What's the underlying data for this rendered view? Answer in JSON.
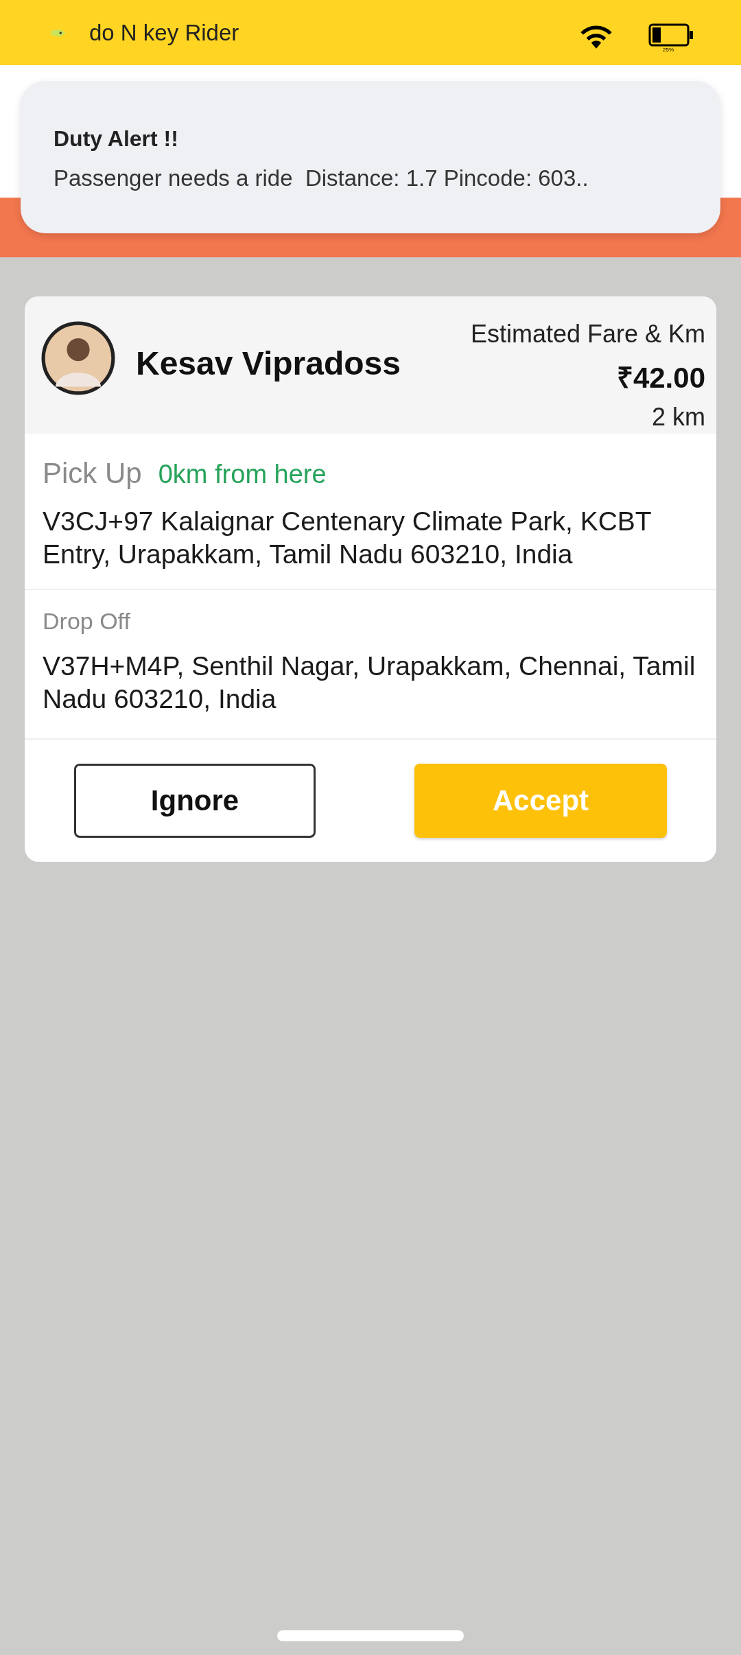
{
  "status_bar": {
    "app_name": "do N key Rider",
    "battery_label": "25%"
  },
  "notification": {
    "title": "Duty Alert !!",
    "message": "Passenger needs a ride  Distance: 1.7 Pincode: 603.."
  },
  "request": {
    "rider_name": "Kesav Vipradoss",
    "fare_label": "Estimated Fare & Km",
    "fare": "₹42.00",
    "distance": "2 km",
    "pickup": {
      "label": "Pick Up",
      "hint": "0km from here",
      "address": "V3CJ+97 Kalaignar Centenary Climate Park, KCBT Entry, Urapakkam, Tamil Nadu 603210, India"
    },
    "dropoff": {
      "label": "Drop Off",
      "address": "V37H+M4P, Senthil Nagar, Urapakkam, Chennai, Tamil Nadu 603210, India"
    },
    "buttons": [
      {
        "label": "Ignore",
        "kind": "outline"
      },
      {
        "label": "Accept",
        "kind": "primary"
      }
    ]
  }
}
